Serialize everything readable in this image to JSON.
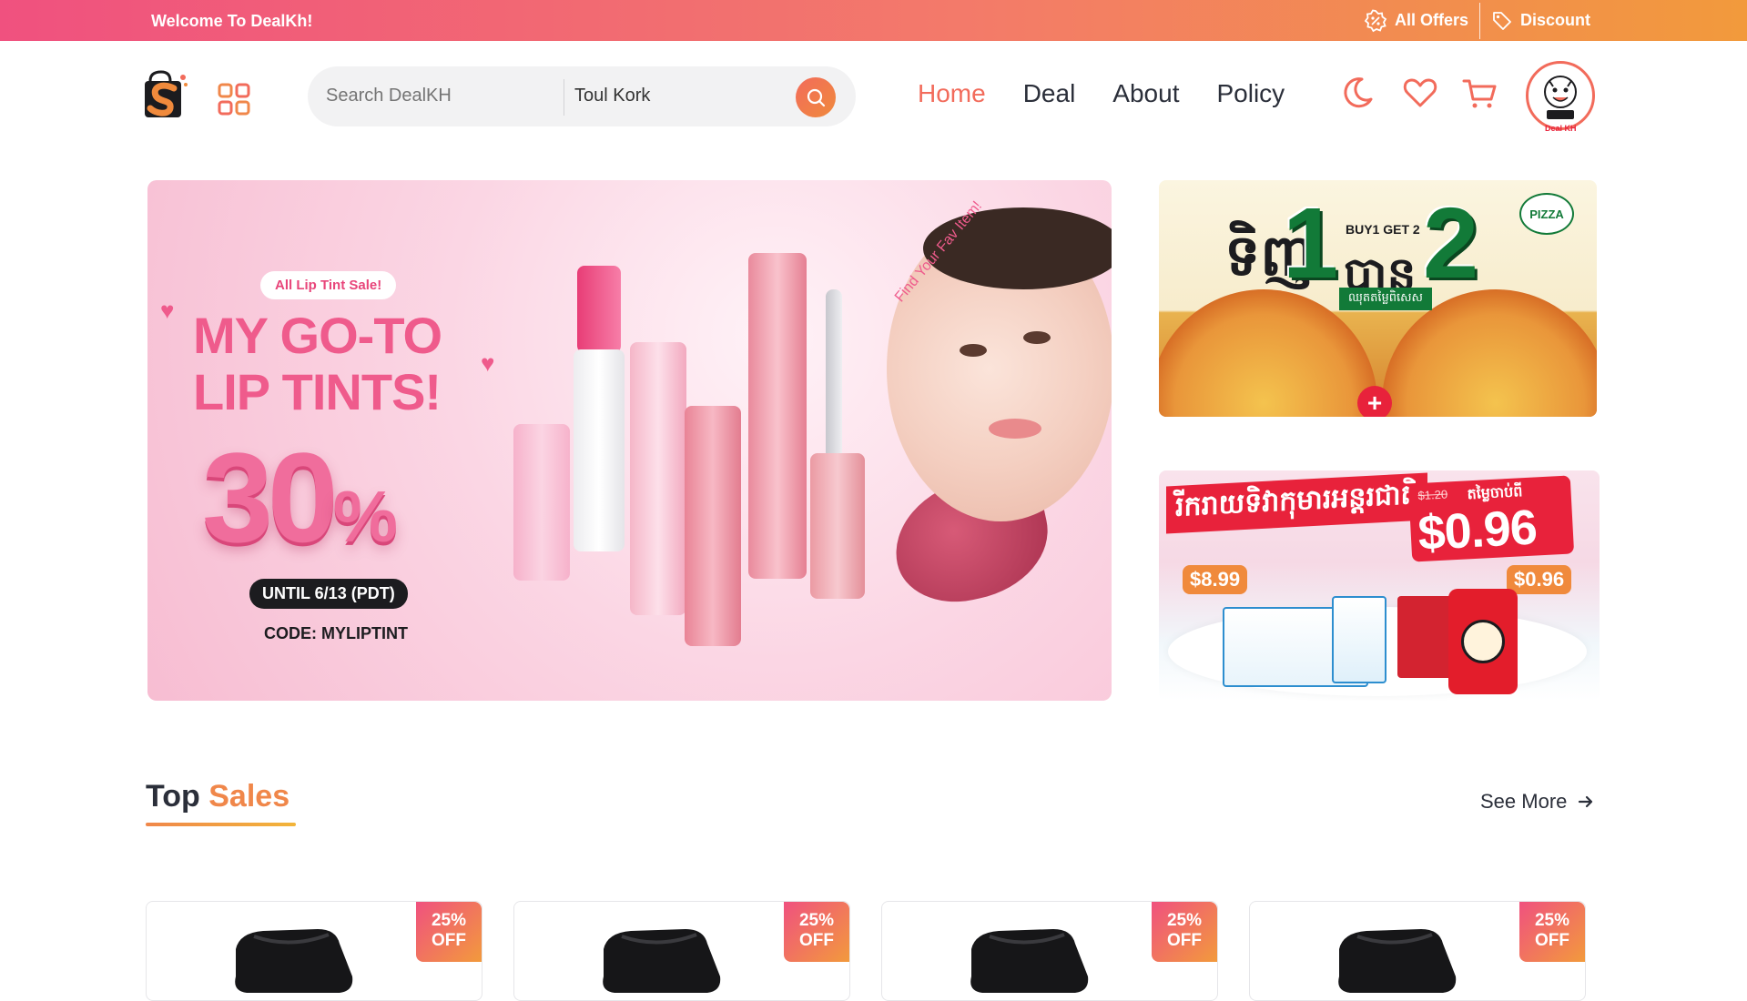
{
  "topbar": {
    "welcome": "Welcome To DealKh!",
    "links": [
      {
        "label": "All Offers",
        "icon": "percent-badge-icon"
      },
      {
        "label": "Discount",
        "icon": "price-tag-icon"
      }
    ]
  },
  "header": {
    "search_placeholder": "Search DealKH",
    "location_value": "Toul Kork",
    "nav": [
      {
        "label": "Home",
        "active": true
      },
      {
        "label": "Deal",
        "active": false
      },
      {
        "label": "About",
        "active": false
      },
      {
        "label": "Policy",
        "active": false
      }
    ],
    "icons": [
      "moon-icon",
      "heart-icon",
      "cart-icon"
    ],
    "avatar_label": "Deal KH"
  },
  "hero": {
    "pill": "All Lip Tint Sale!",
    "headline": "MY GO-TO LIP TINTS!",
    "percent": "30",
    "percent_sign": "%",
    "until": "UNTIL 6/13 (PDT)",
    "code": "CODE: MYLIPTINT",
    "arc_text": "Find Your Fav Item!"
  },
  "side_banner_1": {
    "buy": "BUY1 GET 2",
    "num1": "1",
    "num2": "2",
    "khmer_left": "ទិញ",
    "khmer_right": "បាន",
    "badge": "ឈុតតម្លៃពិសេស",
    "brand": "PIZZA"
  },
  "side_banner_2": {
    "khmer_title": "រីករាយទិវាកុមារអន្តរជាតិ",
    "old_price": "$1.20",
    "price_label": "តម្លៃចាប់ពី",
    "price": "$0.96",
    "tag1": "$8.99",
    "tag2": "$0.96"
  },
  "top_sales": {
    "title_a": "Top",
    "title_b": "Sales",
    "see_more": "See More",
    "cards": [
      {
        "discount": "25%",
        "off": "OFF"
      },
      {
        "discount": "25%",
        "off": "OFF"
      },
      {
        "discount": "25%",
        "off": "OFF"
      },
      {
        "discount": "25%",
        "off": "OFF"
      }
    ]
  },
  "colors": {
    "accent": "#f26b5b",
    "accent_orange": "#f0874a",
    "brand_pink": "#f0517f"
  }
}
